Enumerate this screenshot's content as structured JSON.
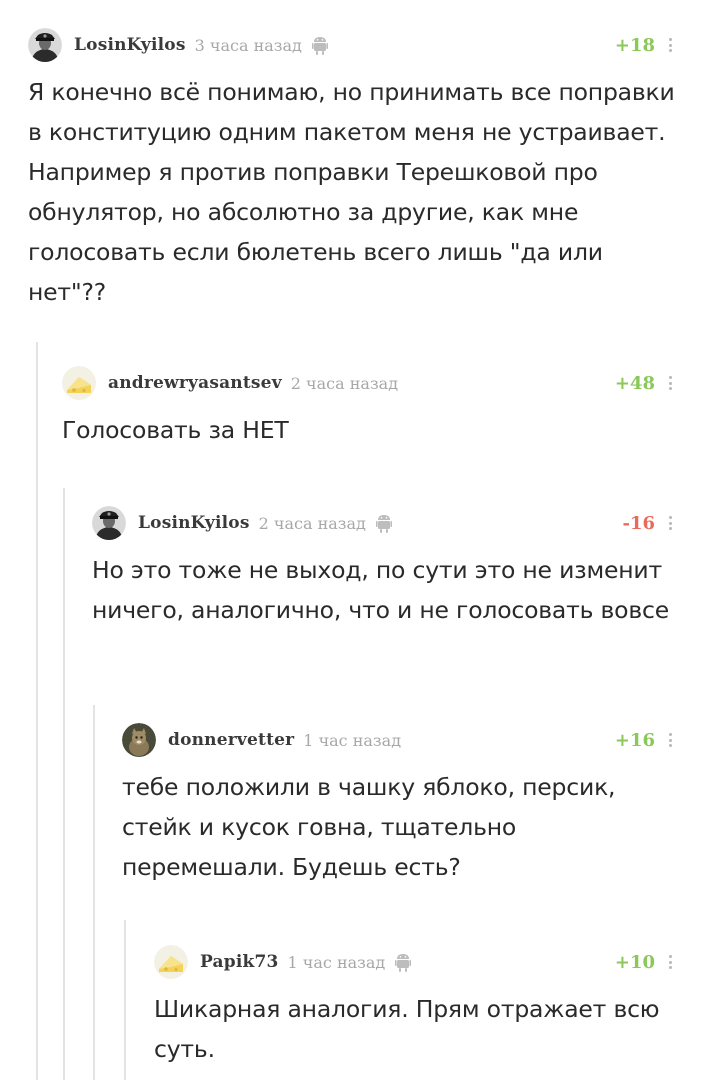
{
  "comments": [
    {
      "username": "LosinKyilos",
      "time": "3 часа назад",
      "device_icon": "android-icon",
      "avatar_icon": "soldier-avatar",
      "rating": "+18",
      "text": "Я конечно всё понимаю, но принимать все поправки в конституцию одним пакетом меня не устраивает. Например я против поправки Терешковой про обнулятор, но абсолютно за другие, как мне голосовать если бюлетень всего лишь \"да или нет\"??"
    },
    {
      "username": "andrewryasantsev",
      "time": "2 часа назад",
      "avatar_icon": "cheese-avatar",
      "rating": "+48",
      "text": "Голосовать за НЕТ"
    },
    {
      "username": "LosinKyilos",
      "time": "2 часа назад",
      "device_icon": "android-icon",
      "avatar_icon": "soldier-avatar",
      "rating": "-16",
      "text": "Но это тоже не выход, по сути это не изменит ничего, аналогично, что и не голосовать вовсе"
    },
    {
      "username": "donnervetter",
      "time": "1 час назад",
      "avatar_icon": "cat-avatar",
      "rating": "+16",
      "text": "тебе положили в чашку яблоко, персик, стейк и кусок говна, тщательно перемешали. Будешь есть?"
    },
    {
      "username": "Papik73",
      "time": "1 час назад",
      "device_icon": "android-icon",
      "avatar_icon": "cheese-avatar",
      "rating": "+10",
      "text": "Шикарная аналогия. Прям отражает всю суть."
    }
  ],
  "colors": {
    "rating_positive": "#8ac858",
    "rating_negative": "#e86b5a",
    "thread_line": "#e3e3e3"
  }
}
